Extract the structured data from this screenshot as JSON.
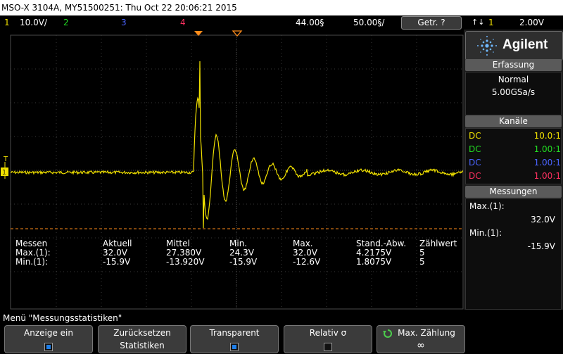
{
  "title_bar": "MSO-X 3104A, MY51500251: Thu Oct 22 20:06:21 2015",
  "channel_bar": {
    "ch1_num": "1",
    "ch1_scale": "10.0V/",
    "ch2_num": "2",
    "ch3_num": "3",
    "ch4_num": "4",
    "time_pos": "44.00§",
    "time_scale": "50.00§/",
    "trigger_button": "Getr. ?",
    "trig_icon": "↑↓",
    "trig_ch": "1",
    "trig_level": "2.00V"
  },
  "colors": {
    "ch1": "#f0e000",
    "ch2": "#22dd22",
    "ch3": "#4a64ff",
    "ch4": "#ff3060",
    "marker": "#ff8c1a"
  },
  "logo": {
    "brand": "Agilent",
    "icon": "agilent-spark-icon"
  },
  "acquisition": {
    "header": "Erfassung",
    "mode": "Normal",
    "rate": "5.00GSa/s"
  },
  "channels": {
    "header": "Kanäle",
    "rows": [
      {
        "coupling": "DC",
        "ratio": "10.0:1"
      },
      {
        "coupling": "DC",
        "ratio": "1.00:1"
      },
      {
        "coupling": "DC",
        "ratio": "1.00:1"
      },
      {
        "coupling": "DC",
        "ratio": "1.00:1"
      }
    ]
  },
  "measurements": {
    "header": "Messungen",
    "m1_label": "Max.(1):",
    "m1_value": "32.0V",
    "m2_label": "Min.(1):",
    "m2_value": "-15.9V"
  },
  "stats_table": {
    "headers": [
      "Messen",
      "Aktuell",
      "Mittel",
      "Min.",
      "Max.",
      "Stand.-Abw.",
      "Zählwert"
    ],
    "rows": [
      [
        "Max.(1):",
        "32.0V",
        "27.380V",
        "24.3V",
        "32.0V",
        "4.2175V",
        "5"
      ],
      [
        "Min.(1):",
        "-15.9V",
        "-13.920V",
        "-15.9V",
        "-12.6V",
        "1.8075V",
        "5"
      ]
    ]
  },
  "ground_marker": "1",
  "trigger_marker": "T",
  "menu_label": "Menü \"Messungsstatistiken\"",
  "softkeys": {
    "k1_label": "Anzeige ein",
    "k2_line1": "Zurücksetzen",
    "k2_line2": "Statistiken",
    "k3_label": "Transparent",
    "k4_label": "Relativ σ",
    "k5_label": "Max. Zählung",
    "k5_value": "∞"
  }
}
